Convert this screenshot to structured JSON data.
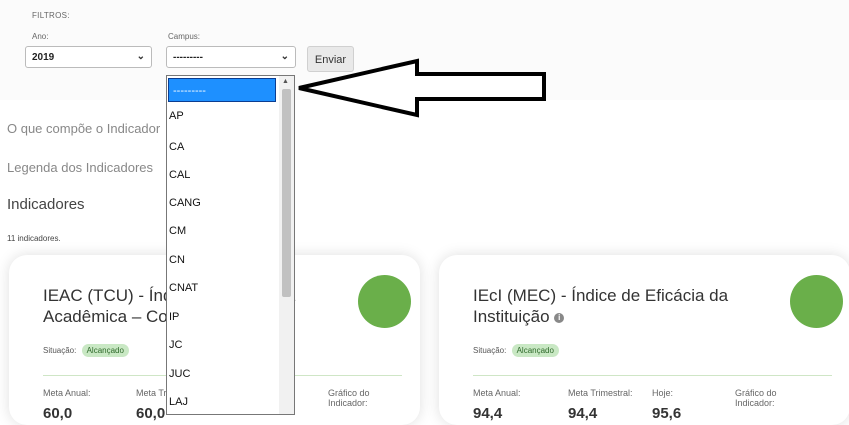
{
  "filters": {
    "title": "FILTROS:",
    "ano": {
      "label": "Ano:",
      "value": "2019"
    },
    "campus": {
      "label": "Campus:",
      "value": "---------"
    },
    "submit_label": "Enviar"
  },
  "links": {
    "composicao": "O que compõe o Indicador",
    "legenda": "Legenda dos Indicadores"
  },
  "section": {
    "title": "Indicadores",
    "count": "11 indicadores."
  },
  "dropdown": {
    "options": [
      "---------",
      "AP",
      "CA",
      "CAL",
      "CANG",
      "CM",
      "CN",
      "CNAT",
      "IP",
      "JC",
      "JUC",
      "LAJ"
    ]
  },
  "cards": [
    {
      "title_line1": "IEAC (TCU) - Índice de Eficiência",
      "title_line2": "Acadêmica – Concluintes",
      "situacao_label": "Situação:",
      "status": "Alcançado",
      "meta_anual_label": "Meta Anual:",
      "meta_anual_value": "60,0",
      "meta_trimestral_label": "Meta Trimestral:",
      "meta_trimestral_value": "60,0",
      "grafico_label": "Gráfico do Indicador:"
    },
    {
      "title_line1": "IEcI (MEC) - Índice de Eficácia da",
      "title_line2": "Instituição",
      "situacao_label": "Situação:",
      "status": "Alcançado",
      "meta_anual_label": "Meta Anual:",
      "meta_anual_value": "94,4",
      "meta_trimestral_label": "Meta Trimestral:",
      "meta_trimestral_value": "94,4",
      "hoje_label": "Hoje:",
      "hoje_value": "95,6",
      "grafico_label": "Gráfico do Indicador:"
    }
  ],
  "colors": {
    "status_green": "#6aaf4a",
    "selection_blue": "#1e90ff"
  }
}
